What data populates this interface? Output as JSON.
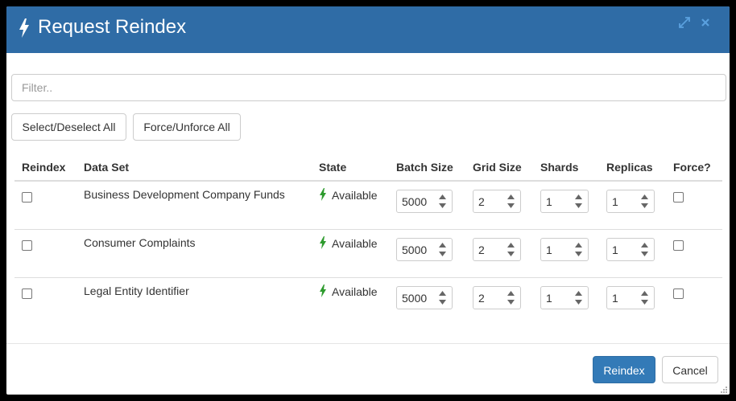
{
  "modal": {
    "title": "Request Reindex",
    "expand_icon": "expand-icon",
    "close_icon": "close-icon"
  },
  "filter": {
    "placeholder": "Filter..",
    "value": ""
  },
  "toolbar": {
    "select_all_label": "Select/Deselect All",
    "force_all_label": "Force/Unforce All"
  },
  "table": {
    "columns": [
      "Reindex",
      "Data Set",
      "State",
      "Batch Size",
      "Grid Size",
      "Shards",
      "Replicas",
      "Force?"
    ],
    "rows": [
      {
        "reindex": false,
        "data_set": "Business Development Company Funds",
        "state": "Available",
        "batch_size": "5000",
        "grid_size": "2",
        "shards": "1",
        "replicas": "1",
        "force": false
      },
      {
        "reindex": false,
        "data_set": "Consumer Complaints",
        "state": "Available",
        "batch_size": "5000",
        "grid_size": "2",
        "shards": "1",
        "replicas": "1",
        "force": false
      },
      {
        "reindex": false,
        "data_set": "Legal Entity Identifier",
        "state": "Available",
        "batch_size": "5000",
        "grid_size": "2",
        "shards": "1",
        "replicas": "1",
        "force": false
      }
    ]
  },
  "footer": {
    "reindex_label": "Reindex",
    "cancel_label": "Cancel"
  },
  "colors": {
    "header": "#2f6ca6",
    "primary": "#337ab7",
    "state_icon": "#2e9b2e"
  }
}
